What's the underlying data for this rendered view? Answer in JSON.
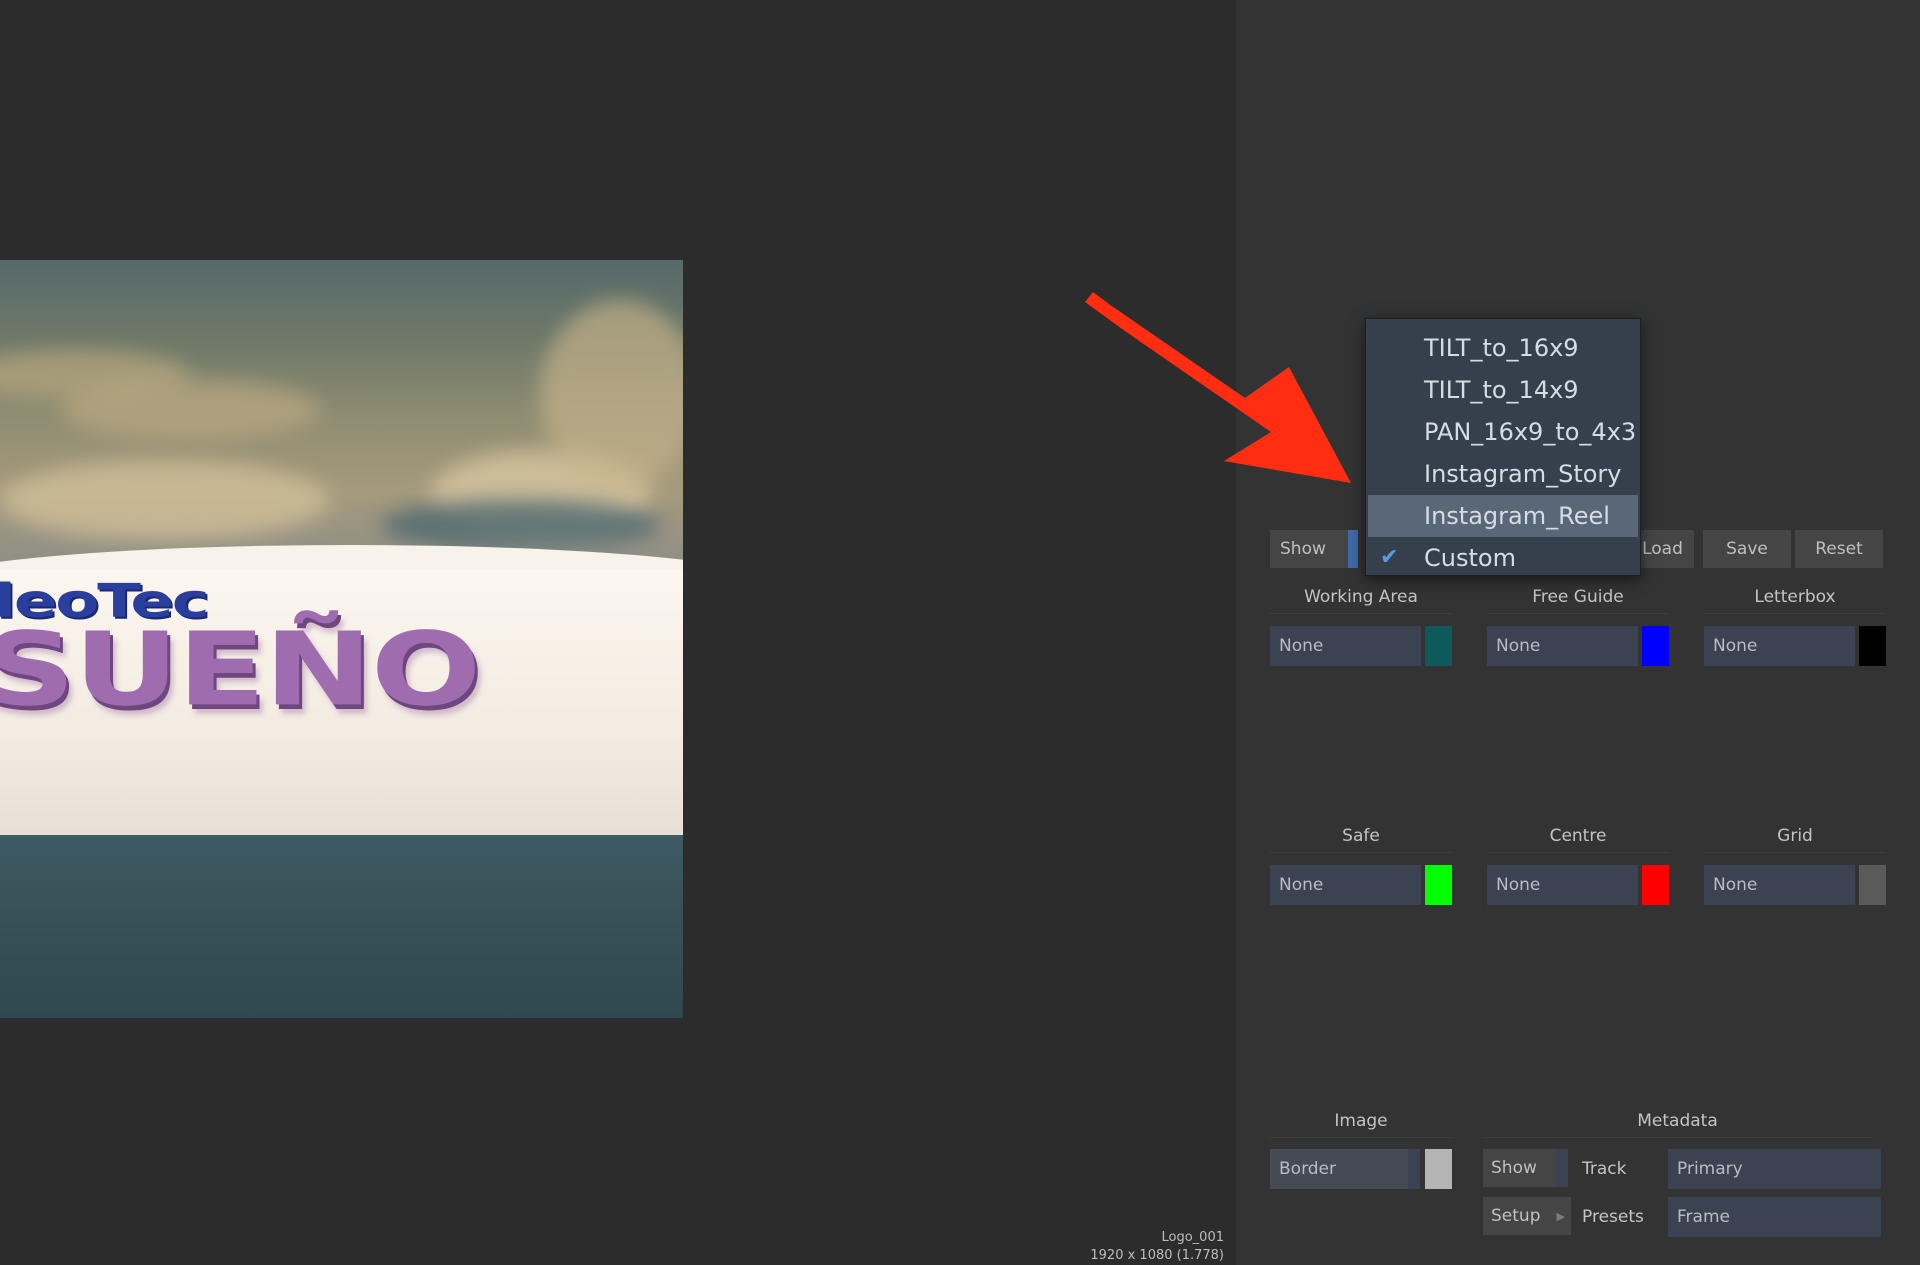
{
  "viewer": {
    "image": {
      "logo_small_text": "deoTec",
      "logo_big_text": "SUEÑO",
      "description": "3D purple and blue logo on white curved band over cloudy sky"
    },
    "clip_name": "Logo_001",
    "clip_resolution": "1920 x 1080 (1.778)"
  },
  "panel": {
    "toolbar": {
      "show_label": "Show",
      "load_label": "Load",
      "save_label": "Save",
      "reset_label": "Reset"
    },
    "dropdown": {
      "items": [
        "TILT_to_16x9",
        "TILT_to_14x9",
        "PAN_16x9_to_4x3",
        "Instagram_Story",
        "Instagram_Reel",
        "Custom"
      ],
      "highlighted": "Instagram_Reel",
      "checked": "Custom"
    },
    "overlays_row1": [
      {
        "title": "Working Area",
        "value": "None",
        "color": "#0e5a5a"
      },
      {
        "title": "Free Guide",
        "value": "None",
        "color": "#0000ff"
      },
      {
        "title": "Letterbox",
        "value": "None",
        "color": "#000000"
      }
    ],
    "overlays_row2": [
      {
        "title": "Safe",
        "value": "None",
        "color": "#00ff00"
      },
      {
        "title": "Centre",
        "value": "None",
        "color": "#ff0000"
      },
      {
        "title": "Grid",
        "value": "None",
        "color": "#5a5a5a"
      }
    ],
    "image_section": {
      "title": "Image",
      "border_label": "Border",
      "border_color": "#b4b4b4"
    },
    "metadata": {
      "title": "Metadata",
      "show_label": "Show",
      "track_label": "Track",
      "track_value": "Primary",
      "setup_label": "Setup",
      "presets_label": "Presets",
      "presets_value": "Frame"
    }
  }
}
